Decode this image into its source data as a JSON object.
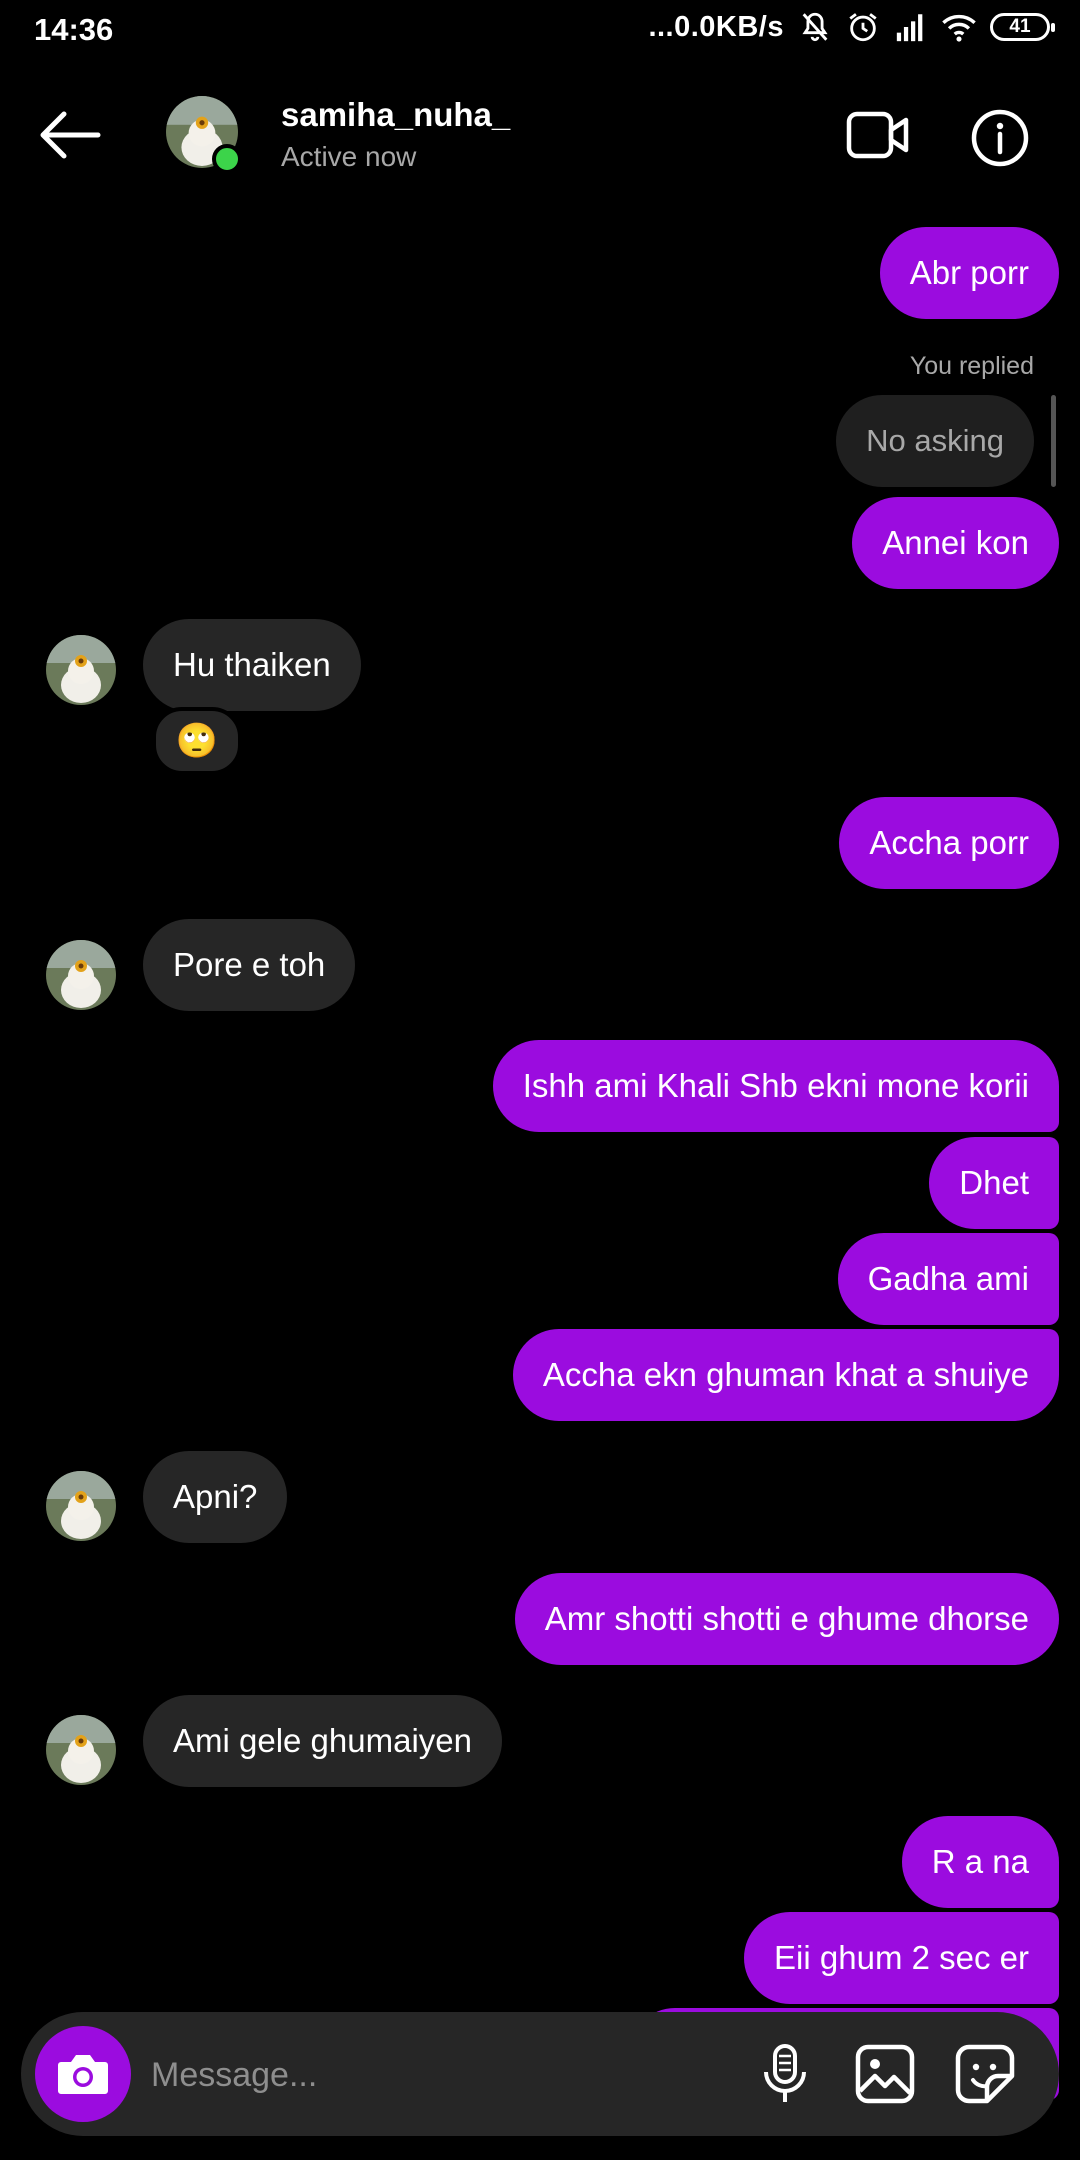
{
  "status_bar": {
    "time": "14:36",
    "network_speed": "...0.0KB/s",
    "battery": "41",
    "icons": [
      "mute-icon",
      "alarm-icon",
      "signal-icon",
      "wifi-icon",
      "battery-icon"
    ]
  },
  "header": {
    "username": "samiha_nuha_",
    "status": "Active now"
  },
  "thread": {
    "reply": {
      "label": "You replied",
      "quoted_text": "No asking"
    },
    "messages": [
      {
        "from": "me",
        "text": "Abr porr"
      },
      {
        "from": "me",
        "text": "Annei kon"
      },
      {
        "from": "them",
        "text": "Hu thaiken",
        "reaction": "🙄"
      },
      {
        "from": "me",
        "text": "Accha porr"
      },
      {
        "from": "them",
        "text": "Pore e toh"
      },
      {
        "from": "me",
        "text": "Ishh ami Khali Shb ekni mone korii"
      },
      {
        "from": "me",
        "text": "Dhet"
      },
      {
        "from": "me",
        "text": "Gadha ami"
      },
      {
        "from": "me",
        "text": "Accha ekn ghuman khat a shuiye"
      },
      {
        "from": "them",
        "text": "Apni?"
      },
      {
        "from": "me",
        "text": "Amr shotti shotti e ghume dhorse"
      },
      {
        "from": "them",
        "text": "Ami gele ghumaiyen"
      },
      {
        "from": "me",
        "text": "R a na"
      },
      {
        "from": "me",
        "text": "Eii ghum 2 sec er"
      }
    ]
  },
  "composer": {
    "placeholder": "Message..."
  },
  "colors": {
    "outgoing_bubble": "#9b0cdf",
    "incoming_bubble": "#262626",
    "online": "#3cd44a",
    "background": "#000000"
  }
}
